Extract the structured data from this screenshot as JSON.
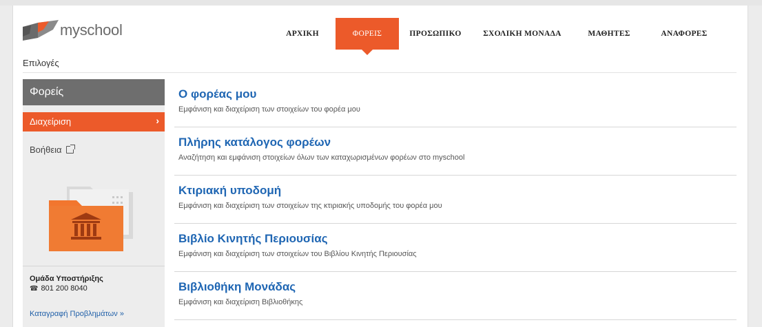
{
  "brand": {
    "name_prefix": "my",
    "name_suffix": "school",
    "accent_color": "#ec5a2a"
  },
  "nav": {
    "items": [
      {
        "label": "ΑΡΧΙΚΗ",
        "active": false
      },
      {
        "label": "ΦΟΡΕΙΣ",
        "active": true
      },
      {
        "label": "ΠΡΟΣΩΠΙΚΟ",
        "active": false
      },
      {
        "label": "ΣΧΟΛΙΚΗ ΜΟΝΑΔΑ",
        "active": false
      },
      {
        "label": "ΜΑΘΗΤΕΣ",
        "active": false
      },
      {
        "label": "ΑΝΑΦΟΡΕΣ",
        "active": false
      }
    ]
  },
  "options_label": "Επιλογές",
  "sidebar": {
    "title": "Φορείς",
    "active_item": "Διαχείριση",
    "help_label": "Βοήθεια",
    "support_title": "Ομάδα Υποστήριξης",
    "support_phone": "801 200 8040",
    "support_link": "Καταγραφή Προβλημάτων »",
    "icons": {
      "folder": "folder-institution-icon",
      "external": "external-link-icon",
      "phone": "phone-icon",
      "chevron": "chevron-right-icon"
    }
  },
  "main": {
    "entries": [
      {
        "title": "Ο φορέας μου",
        "desc": "Εμφάνιση και διαχείριση των στοιχείων του φορέα μου"
      },
      {
        "title": "Πλήρης κατάλογος φορέων",
        "desc": "Αναζήτηση και εμφάνιση στοιχείων όλων των καταχωρισμένων φορέων στο myschool"
      },
      {
        "title": "Κτιριακή υποδομή",
        "desc": "Εμφάνιση και διαχείριση των στοιχείων της κτιριακής υποδομής του φορέα μου"
      },
      {
        "title": "Βιβλίο Κινητής Περιουσίας",
        "desc": "Εμφάνιση και διαχείριση των στοιχείων του Βιβλίου Κινητής Περιουσίας"
      },
      {
        "title": "Βιβλιοθήκη Μονάδας",
        "desc": "Εμφάνιση και διαχείριση Βιβλιοθήκης"
      }
    ]
  }
}
